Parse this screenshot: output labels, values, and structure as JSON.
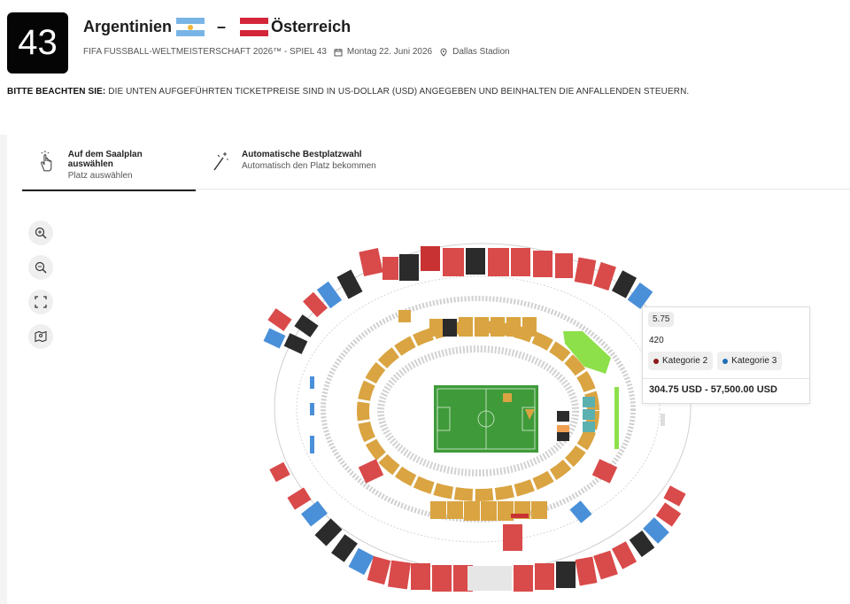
{
  "match": {
    "number": "43",
    "team_home": "Argentinien",
    "team_away": "Österreich",
    "separator": "–",
    "competition": "FIFA FUSSBALL-WELTMEISTERSCHAFT 2026™ - SPIEL 43",
    "date": "Montag 22. Juni 2026",
    "venue": "Dallas Stadion"
  },
  "notice": {
    "label": "BITTE BEACHTEN SIE:",
    "text": "DIE UNTEN AUFGEFÜHRTEN TICKETPREISE SIND IN US-DOLLAR (USD) ANGEGEBEN UND BEINHALTEN DIE ANFALLENDEN STEUERN."
  },
  "tabs": [
    {
      "title": "Auf dem Saalplan auswählen",
      "subtitle": "Platz auswählen",
      "icon": "hand-pointer-icon",
      "active": true
    },
    {
      "title": "Automatische Bestplatzwahl",
      "subtitle": "Automatisch den Platz bekommen",
      "icon": "magic-wand-icon",
      "active": false
    }
  ],
  "map_controls": [
    "zoom-in-icon",
    "zoom-out-icon",
    "fullscreen-icon",
    "map-pin-icon"
  ],
  "tooltip": {
    "price": "5.75",
    "seats": "420",
    "categories": [
      {
        "name": "Kategorie 2",
        "color": "#8b1a1a"
      },
      {
        "name": "Kategorie 3",
        "color": "#1f6fb5"
      }
    ],
    "range": "304.75 USD - 57,500.00 USD"
  },
  "colors": {
    "category_1": "#d94a4a",
    "category_2": "#8b1a1a",
    "category_3": "#4a90d9",
    "category_4": "#d9a441",
    "unavailable": "#2b2b2b",
    "selected": "#8ee04a",
    "pitch": "#3f9a3a"
  }
}
